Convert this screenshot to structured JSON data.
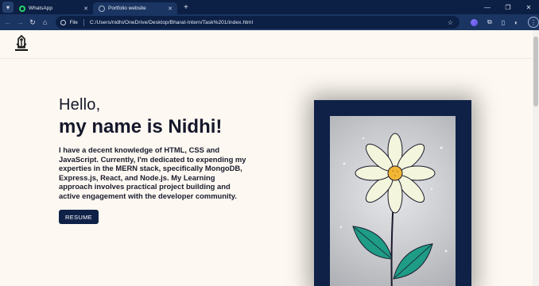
{
  "browser": {
    "tabs": [
      {
        "label": "WhatsApp",
        "icon": "whatsapp-icon",
        "active": false
      },
      {
        "label": "Portfolio website",
        "icon": "globe-icon",
        "active": true
      }
    ],
    "address": {
      "scheme_label": "File",
      "url": "C:/Users/nidhi/OneDrive/Desktop/Bharat-Intern/Task%201/index.html"
    }
  },
  "hero": {
    "hello": "Hello,",
    "name": "my name is Nidhi!",
    "bio": "I have a decent knowledge of HTML, CSS and JavaScript. Currently, I'm dedicated to expending my experties in the MERN stack, specifically MongoDB, Express.js, React, and Node.js. My Learning approach involves practical project building and active engagement with the developer community.",
    "resume_label": "RESUME"
  },
  "colors": {
    "browser_dark": "#0c1f44",
    "browser_toolbar": "#1b3563",
    "page_bg": "#fdf8f1",
    "navy": "#0f2147",
    "petal": "#f3f5dc",
    "flower_center": "#f2b636",
    "leaf": "#1f9c86"
  }
}
